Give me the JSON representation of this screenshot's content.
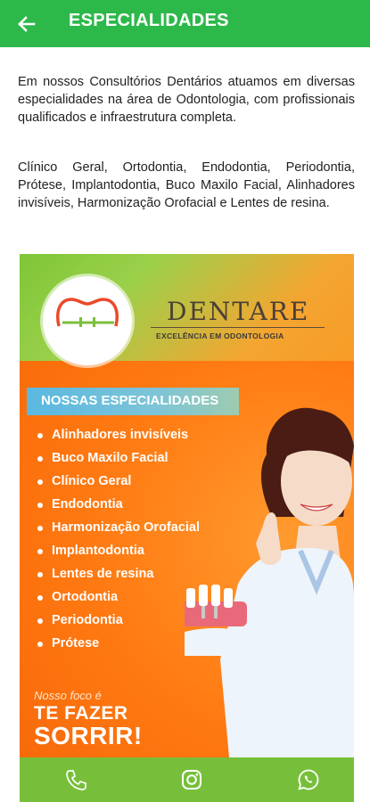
{
  "appbar": {
    "title": "ESPECIALIDADES",
    "back_icon": "arrow-left-icon"
  },
  "intro": {
    "paragraph1": "Em nossos Consultórios Dentários atuamos em diversas especialidades na área de Odontologia, com profissionais qualificados e infraestrutura completa.",
    "paragraph2": "Clínico Geral, Ortodontia, Endodontia, Periodontia, Prótese, Implantodontia, Buco Maxilo Facial, Alinhadores invisíveis, Harmonização Orofacial e Lentes de resina."
  },
  "banner": {
    "brand": "DENTARE",
    "tagline": "EXCELÊNCIA EM ODONTOLOGIA",
    "section_title": "NOSSAS ESPECIALIDADES",
    "items": [
      "Alinhadores invisíveis",
      "Buco Maxilo Facial",
      "Clínico Geral",
      "Endodontia",
      "Harmonização Orofacial",
      "Implantodontia",
      "Lentes de resina",
      "Ortodontia",
      "Periodontia",
      "Prótese"
    ],
    "slogan_line1": "Nosso foco é",
    "slogan_line2": "TE FAZER",
    "slogan_line3": "SORRIR!",
    "footer_icons": [
      "phone-icon",
      "instagram-icon",
      "whatsapp-icon"
    ]
  },
  "colors": {
    "appbar": "#2db84a",
    "banner_orange": "#ff7a12",
    "banner_green": "#77bf3a"
  }
}
